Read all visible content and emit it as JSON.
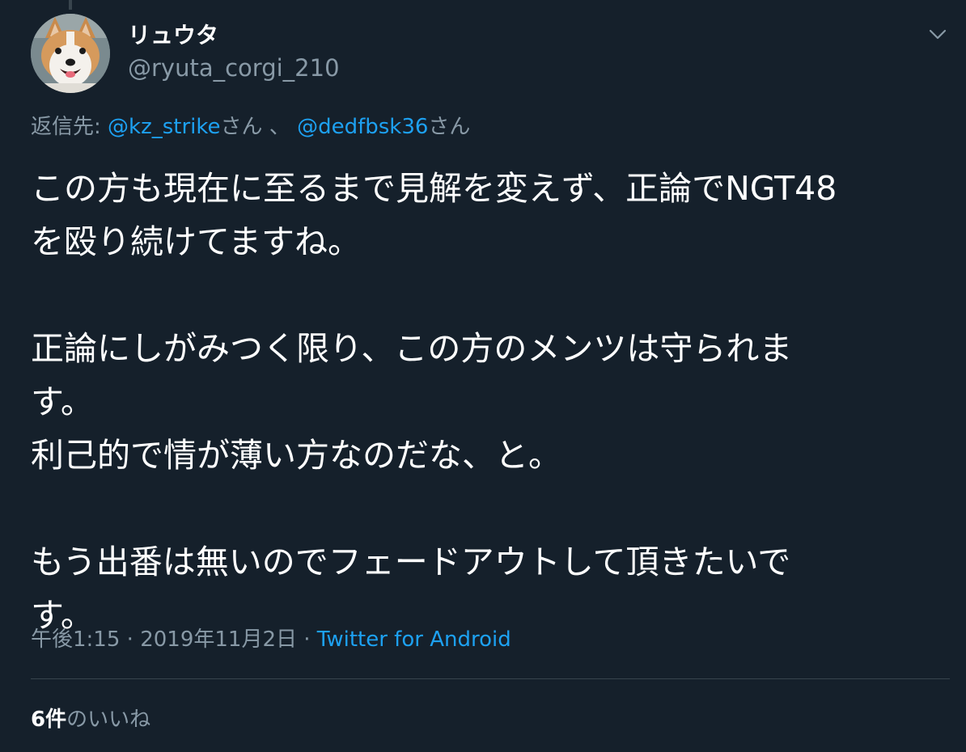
{
  "user": {
    "display_name": "リュウタ",
    "handle": "@ryuta_corgi_210",
    "avatar_icon": "corgi-avatar"
  },
  "reply": {
    "prefix": "返信先: ",
    "mention1": "@kz_strike",
    "suffix1": "さん",
    "separator": " 、 ",
    "mention2": "@dedfbsk36",
    "suffix2": "さん"
  },
  "tweet": {
    "lines": [
      "この方も現在に至るまで見解を変えず、正論でNGT48",
      "を殴り続けてますね。",
      "正論にしがみつく限り、この方のメンツは守られま",
      "す。",
      "利己的で情が薄い方なのだな、と。",
      "もう出番は無いのでフェードアウトして頂きたいで",
      "す。"
    ]
  },
  "meta": {
    "time": "午後1:15",
    "dot": " · ",
    "date": "2019年11月2日",
    "source": "Twitter for Android"
  },
  "stats": {
    "likes_count": "6件",
    "likes_label": "のいいね"
  },
  "colors": {
    "background": "#15202b",
    "accent": "#1da1f2",
    "secondary_text": "#8899a6",
    "divider": "#38444d"
  },
  "icons": {
    "menu": "chevron-down-icon"
  }
}
